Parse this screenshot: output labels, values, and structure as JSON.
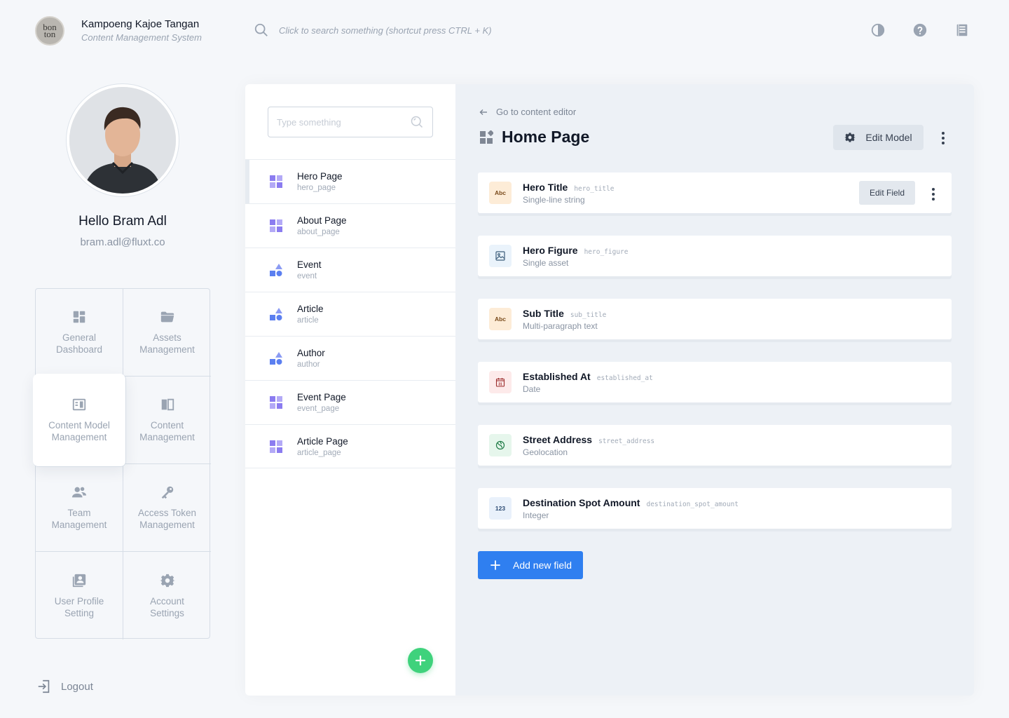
{
  "header": {
    "logo_text": "bon ton",
    "brand_title": "Kampoeng Kajoe Tangan",
    "brand_subtitle": "Content Management System",
    "search_text": "Click to search something (shortcut press CTRL + K)",
    "icons": [
      "contrast-icon",
      "help-icon",
      "notebook-icon"
    ]
  },
  "profile": {
    "greeting": "Hello Bram Adl",
    "email": "bram.adl@fluxt.co"
  },
  "menu": [
    {
      "line1": "General",
      "line2": "Dashboard",
      "icon": "dashboard-icon"
    },
    {
      "line1": "Assets",
      "line2": "Management",
      "icon": "folder-icon"
    },
    {
      "line1": "Content Model",
      "line2": "Management",
      "icon": "layout-icon",
      "active": true
    },
    {
      "line1": "Content",
      "line2": "Management",
      "icon": "book-icon"
    },
    {
      "line1": "Team",
      "line2": "Management",
      "icon": "team-icon"
    },
    {
      "line1": "Access Token",
      "line2": "Management",
      "icon": "key-icon"
    },
    {
      "line1": "User Profile",
      "line2": "Setting",
      "icon": "profile-card-icon"
    },
    {
      "line1": "Account",
      "line2": "Settings",
      "icon": "gear-icon"
    }
  ],
  "logout_label": "Logout",
  "model_list": {
    "search_placeholder": "Type something",
    "items": [
      {
        "name": "Hero Page",
        "key": "hero_page",
        "icon": "grid-icon"
      },
      {
        "name": "About Page",
        "key": "about_page",
        "icon": "grid-icon"
      },
      {
        "name": "Event",
        "key": "event",
        "icon": "shapes-icon"
      },
      {
        "name": "Article",
        "key": "article",
        "icon": "shapes-icon"
      },
      {
        "name": "Author",
        "key": "author",
        "icon": "shapes-icon"
      },
      {
        "name": "Event Page",
        "key": "event_page",
        "icon": "grid-icon"
      },
      {
        "name": "Article Page",
        "key": "article_page",
        "icon": "grid-icon"
      }
    ]
  },
  "detail": {
    "back_label": "Go to content editor",
    "title": "Home Page",
    "edit_model_label": "Edit Model",
    "edit_field_label": "Edit Field",
    "add_field_label": "Add new field",
    "fields": [
      {
        "name": "Hero Title",
        "key": "hero_title",
        "type": "Single-line string",
        "badge": "Abc",
        "badge_bg": "#fdecd7",
        "badge_fg": "#7a4b1c",
        "icon": "text-icon"
      },
      {
        "name": "Hero Figure",
        "key": "hero_figure",
        "type": "Single asset",
        "badge": "",
        "badge_bg": "#eaf3fb",
        "badge_fg": "#3c5d7a",
        "icon": "image-icon"
      },
      {
        "name": "Sub Title",
        "key": "sub_title",
        "type": "Multi-paragraph text",
        "badge": "Abc",
        "badge_bg": "#fdecd7",
        "badge_fg": "#7a4b1c",
        "icon": "text-icon"
      },
      {
        "name": "Established At",
        "key": "established_at",
        "type": "Date",
        "badge": "",
        "badge_bg": "#fdeaea",
        "badge_fg": "#9b2c2c",
        "icon": "calendar-icon"
      },
      {
        "name": "Street Address",
        "key": "street_address",
        "type": "Geolocation",
        "badge": "",
        "badge_bg": "#e6f6ec",
        "badge_fg": "#1e7a45",
        "icon": "globe-icon"
      },
      {
        "name": "Destination Spot Amount",
        "key": "destination_spot_amount",
        "type": "Integer",
        "badge": "123",
        "badge_bg": "#e9f1fb",
        "badge_fg": "#2b4a72",
        "icon": "number-icon"
      }
    ]
  },
  "colors": {
    "accent_blue": "#2f7ff0",
    "accent_green": "#3fd27c",
    "icon_purple": "#8b7cf0",
    "icon_blue": "#5b7ff0"
  }
}
